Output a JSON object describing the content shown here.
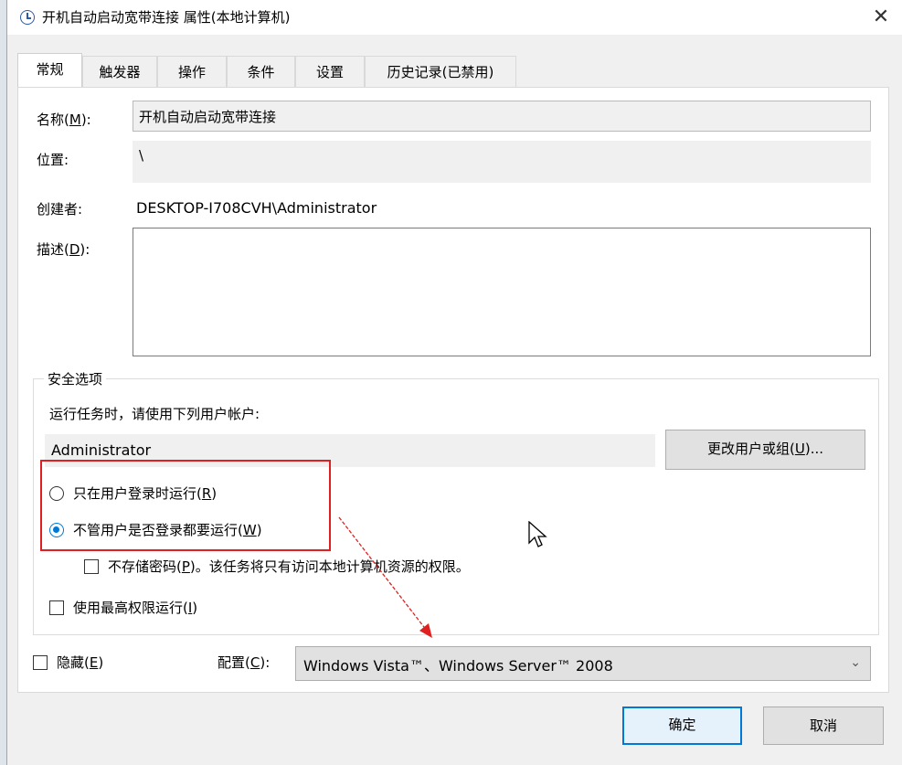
{
  "window": {
    "title": "开机自动启动宽带连接 属性(本地计算机)",
    "close_glyph": "✕"
  },
  "tabs": [
    {
      "label": "常规",
      "active": true
    },
    {
      "label": "触发器",
      "active": false
    },
    {
      "label": "操作",
      "active": false
    },
    {
      "label": "条件",
      "active": false
    },
    {
      "label": "设置",
      "active": false
    },
    {
      "label": "历史记录(已禁用)",
      "active": false
    }
  ],
  "general": {
    "name_label_pre": "名称(",
    "name_label_key": "M",
    "name_label_post": "):",
    "name_value": "开机自动启动宽带连接",
    "location_label": "位置:",
    "location_value": "\\",
    "author_label": "创建者:",
    "author_value": "DESKTOP-I708CVH\\Administrator",
    "desc_label_pre": "描述(",
    "desc_label_key": "D",
    "desc_label_post": "):",
    "desc_value": ""
  },
  "security": {
    "group_title": "安全选项",
    "run_as_prompt": "运行任务时，请使用下列用户帐户:",
    "user_account": "Administrator",
    "change_user_pre": "更改用户或组(",
    "change_user_key": "U",
    "change_user_post": ")...",
    "radio_logged_on_pre": "只在用户登录时运行(",
    "radio_logged_on_key": "R",
    "radio_logged_on_post": ")",
    "radio_whether_pre": "不管用户是否登录都要运行(",
    "radio_whether_key": "W",
    "radio_whether_post": ")",
    "no_store_pwd_pre": "不存储密码(",
    "no_store_pwd_key": "P",
    "no_store_pwd_post": ")。该任务将只有访问本地计算机资源的权限。",
    "highest_priv_pre": "使用最高权限运行(",
    "highest_priv_key": "I",
    "highest_priv_post": ")"
  },
  "bottom": {
    "hidden_pre": "隐藏(",
    "hidden_key": "E",
    "hidden_post": ")",
    "config_label_pre": "配置(",
    "config_label_key": "C",
    "config_label_post": "):",
    "config_value": "Windows Vista™、Windows Server™ 2008"
  },
  "buttons": {
    "ok": "确定",
    "cancel": "取消"
  },
  "colors": {
    "accent": "#0078d7",
    "annotation_red": "#e02020"
  }
}
